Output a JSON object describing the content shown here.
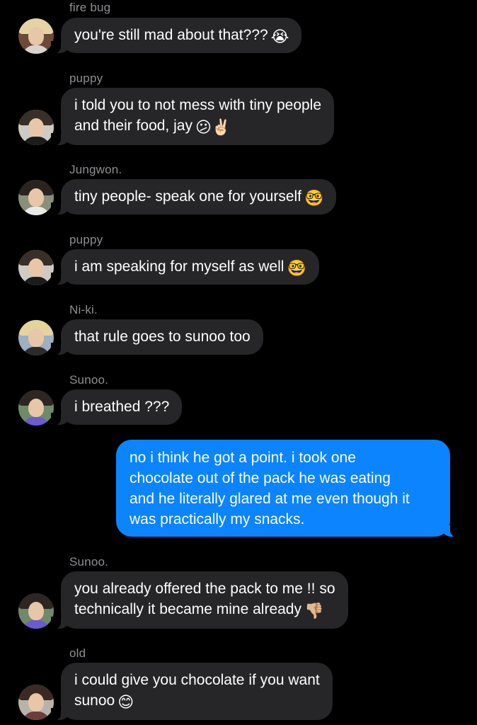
{
  "messages": [
    {
      "sender": "fire bug",
      "lines": [
        "you're still mad about that???"
      ],
      "emoji": "😭"
    },
    {
      "sender": "puppy",
      "lines": [
        "i told you to not mess with tiny people",
        "and their food, jay"
      ],
      "emoji": "😕✌🏻"
    },
    {
      "sender": "Jungwon.",
      "lines": [
        "tiny people- speak one for yourself"
      ],
      "emoji": "🤓"
    },
    {
      "sender": "puppy",
      "lines": [
        "i am speaking for myself as well"
      ],
      "emoji": "🤓"
    },
    {
      "sender": "Ni-ki.",
      "lines": [
        "that rule goes to sunoo too"
      ],
      "emoji": ""
    },
    {
      "sender": "Sunoo.",
      "lines": [
        "i breathed ???"
      ],
      "emoji": ""
    },
    {
      "sender": "",
      "outgoing": true,
      "lines": [
        "no i think he got a point. i took one",
        "chocolate out of the pack he was eating",
        "and he literally glared at me even though it",
        "was practically my snacks."
      ],
      "emoji": ""
    },
    {
      "sender": "Sunoo.",
      "lines": [
        "you already offered the pack to me !! so",
        "technically it became mine already"
      ],
      "emoji": "👎🏼"
    },
    {
      "sender": "old",
      "lines": [
        "i could give you chocolate if you want",
        "sunoo"
      ],
      "emoji": "😊"
    }
  ],
  "colors": {
    "background": "#000000",
    "incoming_bubble": "#262628",
    "outgoing_bubble": "#0b84fe",
    "sender_label": "#8e8e93"
  }
}
